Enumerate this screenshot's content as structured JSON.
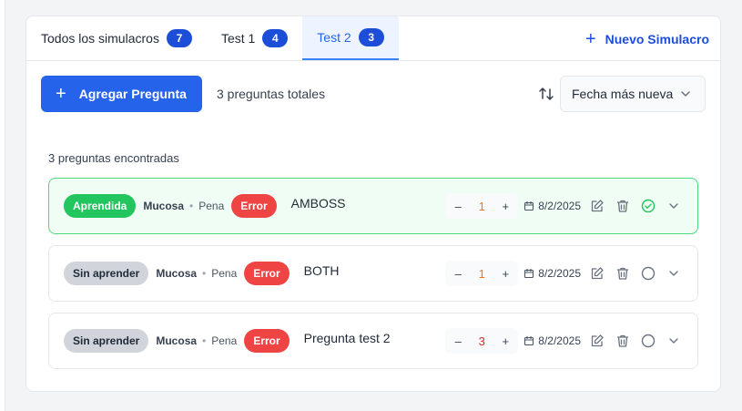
{
  "tabs": [
    {
      "label": "Todos los simulacros",
      "count": "7"
    },
    {
      "label": "Test 1",
      "count": "4"
    },
    {
      "label": "Test 2",
      "count": "3"
    }
  ],
  "new_simulacro_label": "Nuevo Simulacro",
  "toolbar": {
    "add_label": "Agregar Pregunta",
    "total_text": "3 preguntas totales",
    "sort_value": "Fecha más nueva"
  },
  "found_text": "3 preguntas encontradas",
  "questions": [
    {
      "status": "Aprendida",
      "category": "Mucosa",
      "sub": "Pena",
      "tag": "Error",
      "text": "AMBOSS",
      "count": "1",
      "date": "8/2/2025"
    },
    {
      "status": "Sin aprender",
      "category": "Mucosa",
      "sub": "Pena",
      "tag": "Error",
      "text": "BOTH",
      "count": "1",
      "date": "8/2/2025"
    },
    {
      "status": "Sin aprender",
      "category": "Mucosa",
      "sub": "Pena",
      "tag": "Error",
      "text": "Pregunta test 2",
      "count": "3",
      "date": "8/2/2025"
    }
  ],
  "stepper": {
    "minus": "–",
    "plus": "+"
  },
  "colors": {
    "primary": "#2563eb",
    "learned": "#22c55e",
    "error": "#ef4444"
  }
}
